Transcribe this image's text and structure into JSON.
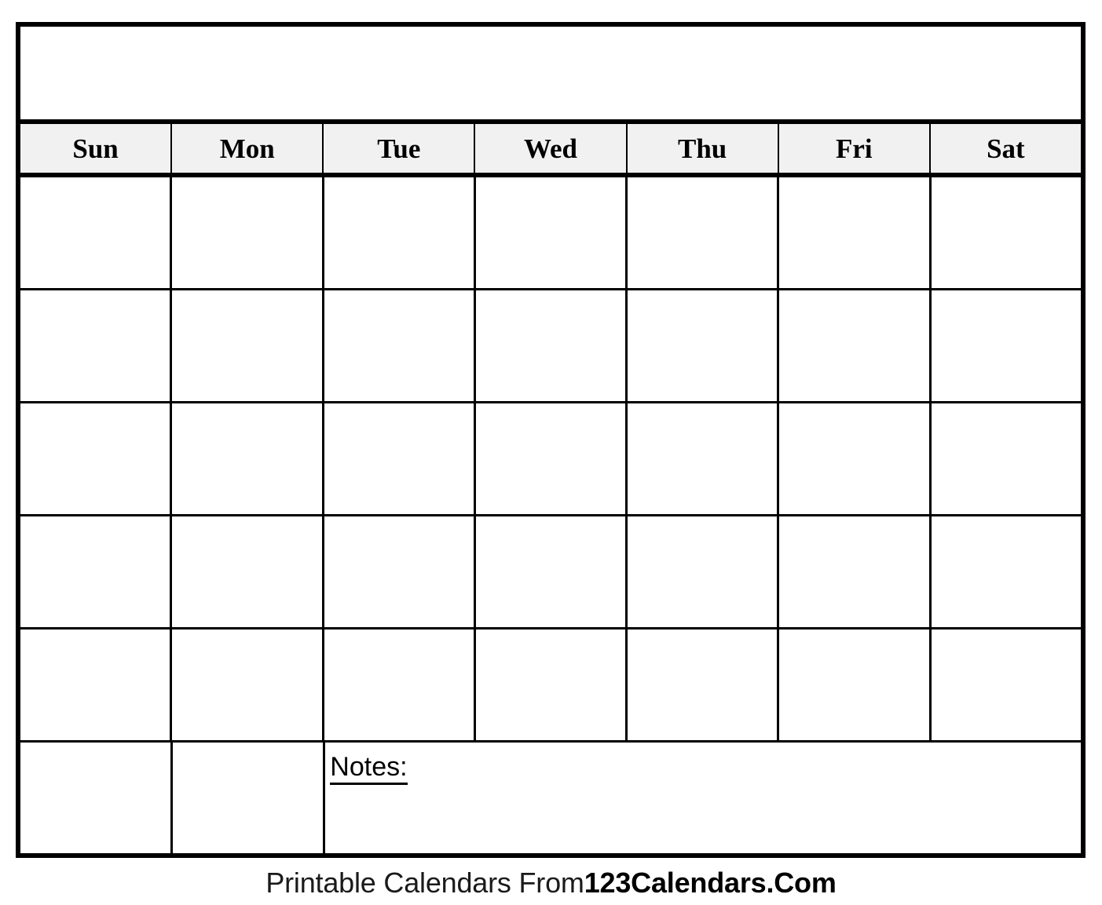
{
  "document": {
    "type": "blank-monthly-calendar",
    "title": "",
    "title_placeholder": ""
  },
  "calendar": {
    "weekday_headers": [
      {
        "label": "Sun"
      },
      {
        "label": "Mon"
      },
      {
        "label": "Tue"
      },
      {
        "label": "Wed"
      },
      {
        "label": "Thu"
      },
      {
        "label": "Fri"
      },
      {
        "label": "Sat"
      }
    ],
    "weeks": [
      {
        "days": [
          "",
          "",
          "",
          "",
          "",
          "",
          ""
        ]
      },
      {
        "days": [
          "",
          "",
          "",
          "",
          "",
          "",
          ""
        ]
      },
      {
        "days": [
          "",
          "",
          "",
          "",
          "",
          "",
          ""
        ]
      },
      {
        "days": [
          "",
          "",
          "",
          "",
          "",
          "",
          ""
        ]
      },
      {
        "days": [
          "",
          "",
          "",
          "",
          "",
          "",
          ""
        ]
      }
    ],
    "last_row": {
      "days": [
        "",
        ""
      ],
      "notes_label": "Notes:",
      "notes_value": ""
    }
  },
  "footer": {
    "prefix": "Printable Calendars From ",
    "brand": "123Calendars.Com"
  },
  "colors": {
    "border": "#000000",
    "header_background": "#f1f1f1",
    "page_background": "#ffffff",
    "text": "#000000"
  }
}
